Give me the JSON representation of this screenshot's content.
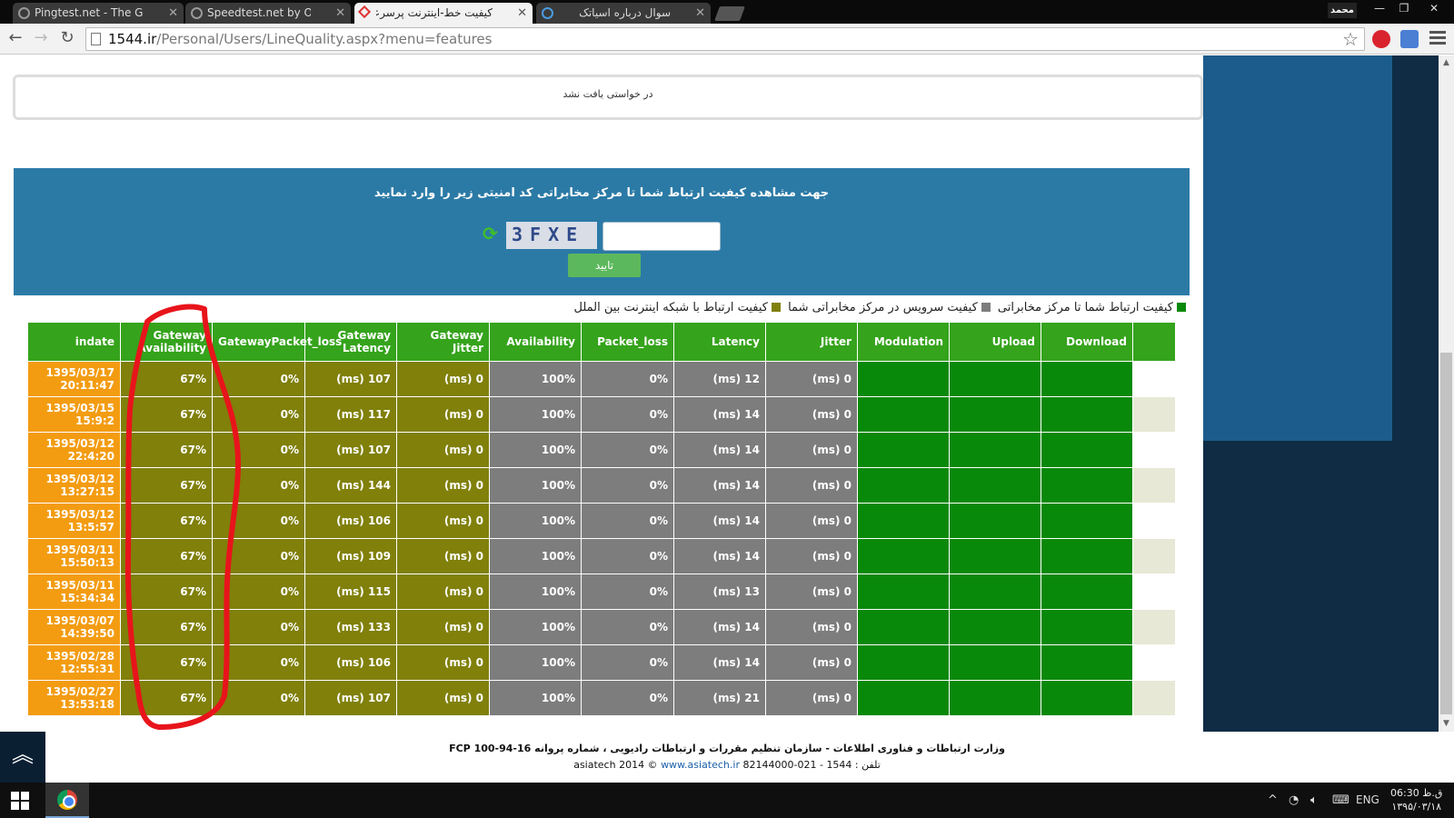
{
  "browser": {
    "tabs": [
      {
        "title": "Pingtest.net - The Global",
        "active": false,
        "rtl": false,
        "icon": "speedometer-icon"
      },
      {
        "title": "Speedtest.net by Ookla -",
        "active": false,
        "rtl": false,
        "icon": "speedometer-icon"
      },
      {
        "title": "کیفیت خط-اینترنت پرسرعت",
        "active": true,
        "rtl": true,
        "icon": "x-logo-icon"
      },
      {
        "title": "سوال درباره اسیاتک",
        "active": false,
        "rtl": true,
        "icon": "forum-icon"
      }
    ],
    "profile_name": "محمد",
    "url_host": "1544.ir",
    "url_path": "/Personal/Users/LineQuality.aspx?menu=features"
  },
  "page": {
    "not_found_message": "در خواستی یافت نشد",
    "captcha": {
      "instruction": "جهت مشاهده کیفیت ارتباط شما تا مرکز مخابراتی کد امنیتی زیر را وارد نمایید",
      "code_image_text": "3FXE",
      "input_value": "",
      "confirm_label": "تایید"
    },
    "legend": [
      {
        "label": "کیفیت ارتباط شما تا مرکز مخابراتی",
        "color": "#098909"
      },
      {
        "label": "کیفیت سرویس در مرکز مخابراتی شما",
        "color": "#7d7d7d"
      },
      {
        "label": "کیفیت ارتباط با شبکه اینترنت بین الملل",
        "color": "#80800b"
      }
    ],
    "table": {
      "headers": [
        "indate",
        "Gateway\nAvailability",
        "GatewayPacket_loss",
        "Gateway\nLatency",
        "Gateway Jitter",
        "Availability",
        "Packet_loss",
        "Latency",
        "Jitter",
        "Modulation",
        "Upload",
        "Download"
      ],
      "rows": [
        [
          "1395/03/17\n20:11:47",
          "67%",
          "0%",
          "(ms) 107",
          "(ms) 0",
          "100%",
          "0%",
          "(ms) 12",
          "(ms) 0",
          "",
          "",
          ""
        ],
        [
          "1395/03/15\n15:9:2",
          "67%",
          "0%",
          "(ms) 117",
          "(ms) 0",
          "100%",
          "0%",
          "(ms) 14",
          "(ms) 0",
          "",
          "",
          ""
        ],
        [
          "1395/03/12\n22:4:20",
          "67%",
          "0%",
          "(ms) 107",
          "(ms) 0",
          "100%",
          "0%",
          "(ms) 14",
          "(ms) 0",
          "",
          "",
          ""
        ],
        [
          "1395/03/12\n13:27:15",
          "67%",
          "0%",
          "(ms) 144",
          "(ms) 0",
          "100%",
          "0%",
          "(ms) 14",
          "(ms) 0",
          "",
          "",
          ""
        ],
        [
          "1395/03/12\n13:5:57",
          "67%",
          "0%",
          "(ms) 106",
          "(ms) 0",
          "100%",
          "0%",
          "(ms) 14",
          "(ms) 0",
          "",
          "",
          ""
        ],
        [
          "1395/03/11\n15:50:13",
          "67%",
          "0%",
          "(ms) 109",
          "(ms) 0",
          "100%",
          "0%",
          "(ms) 14",
          "(ms) 0",
          "",
          "",
          ""
        ],
        [
          "1395/03/11\n15:34:34",
          "67%",
          "0%",
          "(ms) 115",
          "(ms) 0",
          "100%",
          "0%",
          "(ms) 13",
          "(ms) 0",
          "",
          "",
          ""
        ],
        [
          "1395/03/07\n14:39:50",
          "67%",
          "0%",
          "(ms) 133",
          "(ms) 0",
          "100%",
          "0%",
          "(ms) 14",
          "(ms) 0",
          "",
          "",
          ""
        ],
        [
          "1395/02/28\n12:55:31",
          "67%",
          "0%",
          "(ms) 106",
          "(ms) 0",
          "100%",
          "0%",
          "(ms) 14",
          "(ms) 0",
          "",
          "",
          ""
        ],
        [
          "1395/02/27\n13:53:18",
          "67%",
          "0%",
          "(ms) 107",
          "(ms) 0",
          "100%",
          "0%",
          "(ms) 21",
          "(ms) 0",
          "",
          "",
          ""
        ]
      ]
    },
    "footer": {
      "line1": "وزارت ارتباطات و فناوری اطلاعات - سازمان تنظیم مقررات و ارتباطات رادیویی ، شماره پروانه  16-94-100 FCP",
      "line2_prefix": "تلفن : 1544 - 021-82144000 asiatech 2014 © ",
      "line2_link": "www.asiatech.ir"
    }
  },
  "taskbar": {
    "language": "ENG",
    "time": "06:30 ق.ظ",
    "date": "۱۳۹۵/۰۳/۱۸"
  },
  "colors": {
    "header_green": "#35a31c",
    "date_orange": "#f39c12",
    "international_olive": "#80800b",
    "service_grey": "#7d7d7d",
    "line_green": "#098909",
    "captcha_blue": "#2b7aa6",
    "annotation_red": "#e8141b"
  }
}
